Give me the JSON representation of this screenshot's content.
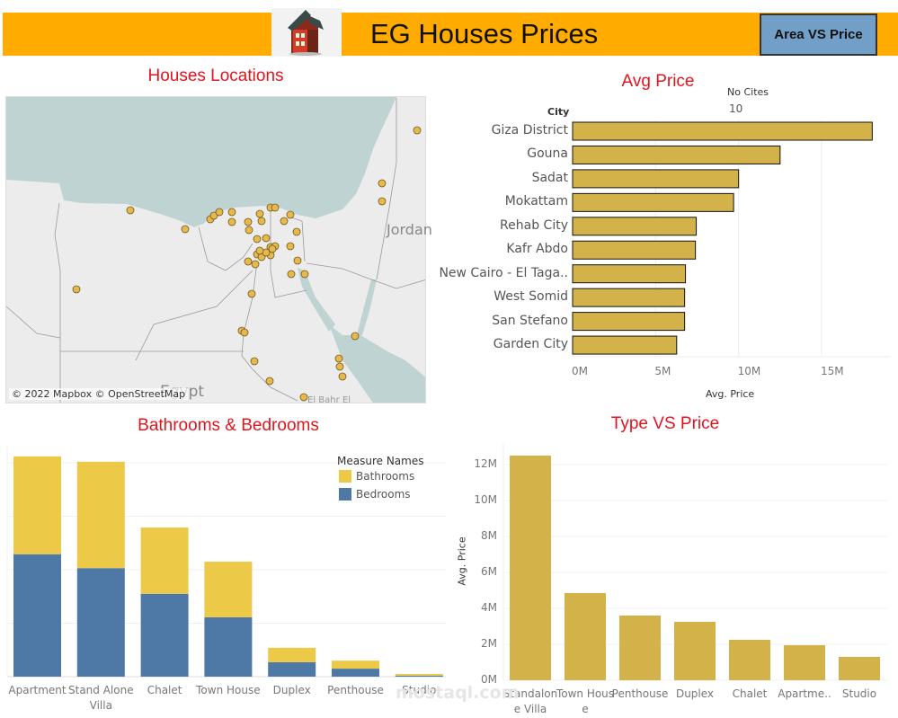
{
  "header": {
    "title": "EG Houses Prices",
    "area_button": "Area VS Price",
    "logo_icon": "house-icon",
    "bg_color": "#FFAB00",
    "button_color": "#729FC8"
  },
  "map_panel": {
    "title": "Houses Locations",
    "credit": "© 2022 Mapbox © OpenStreetMap",
    "labels": {
      "country": "Egypt",
      "neighbor": "Jordan",
      "region": "El Bahr El"
    },
    "point_color": "#E8B84A"
  },
  "avg_price": {
    "title": "Avg Price",
    "filter_label": "No Cites",
    "filter_value": "10"
  },
  "bath_bed": {
    "title": "Bathrooms & Bedrooms"
  },
  "type_price": {
    "title": "Type VS Price"
  },
  "watermark": "mostaql.com",
  "chart_data": [
    {
      "type": "bar",
      "orientation": "horizontal",
      "title": "Avg Price",
      "ylabel": "City",
      "xlabel": "Avg. Price",
      "categories": [
        "Giza District",
        "Gouna",
        "Sadat",
        "Mokattam",
        "Rehab City",
        "Kafr Abdo",
        "New Cairo - El Taga..",
        "West Somid",
        "San Stefano",
        "Garden City"
      ],
      "values": [
        18050000,
        12500000,
        10000000,
        9700000,
        7450000,
        7400000,
        6800000,
        6750000,
        6750000,
        6270000
      ],
      "xticks": [
        "0M",
        "5M",
        "10M",
        "15M"
      ],
      "xlim": [
        0,
        18500000
      ],
      "color": "#D4B24A",
      "grid": true
    },
    {
      "type": "bar",
      "stacked": true,
      "title": "Bathrooms & Bedrooms",
      "categories": [
        "Apartment",
        "Stand Alone Villa",
        "Chalet",
        "Town House",
        "Duplex",
        "Penthouse",
        "Studio"
      ],
      "legend_title": "Measure Names",
      "legend_position": "top-right",
      "series": [
        {
          "name": "Bedrooms",
          "color": "#4E79A7",
          "values": [
            2.29,
            2.03,
            1.55,
            1.11,
            0.27,
            0.15,
            0.02
          ]
        },
        {
          "name": "Bathrooms",
          "color": "#EDC948",
          "values": [
            1.83,
            1.99,
            1.24,
            1.04,
            0.27,
            0.15,
            0.03
          ]
        }
      ],
      "ylim": [
        0,
        4.2
      ],
      "grid": true
    },
    {
      "type": "bar",
      "title": "Type VS Price",
      "ylabel": "Avg. Price",
      "categories": [
        "Standalone Villa",
        "Town House",
        "Penthouse",
        "Duplex",
        "Chalet",
        "Apartme..",
        "Studio"
      ],
      "values": [
        12500000,
        4850000,
        3600000,
        3250000,
        2250000,
        1950000,
        1300000
      ],
      "yticks": [
        "0M",
        "2M",
        "4M",
        "6M",
        "8M",
        "10M",
        "12M"
      ],
      "ylim": [
        0,
        12700000
      ],
      "color": "#D4B24A",
      "grid": true
    }
  ]
}
